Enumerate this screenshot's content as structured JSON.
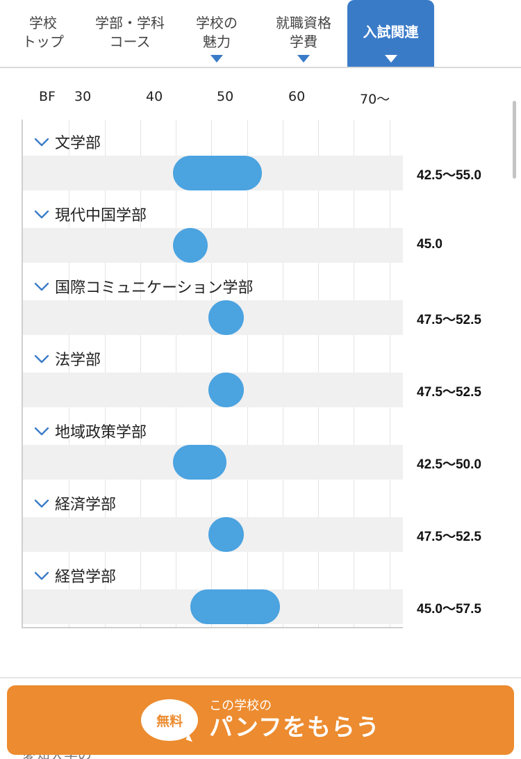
{
  "tabs": [
    {
      "lines": [
        "学校",
        "トップ"
      ],
      "active": false,
      "caret": false
    },
    {
      "lines": [
        "学部・学科",
        "コース"
      ],
      "active": false,
      "caret": false
    },
    {
      "lines": [
        "学校の",
        "魅力"
      ],
      "active": false,
      "caret": true
    },
    {
      "lines": [
        "就職資格",
        "学費"
      ],
      "active": false,
      "caret": true
    },
    {
      "lines": [
        "入試関連"
      ],
      "active": true,
      "caret": true
    }
  ],
  "axis": {
    "bf_label": "BF",
    "ticks": [
      "30",
      "40",
      "50",
      "60",
      "70〜"
    ]
  },
  "chart_data": {
    "type": "bar",
    "categories": [
      "文学部",
      "現代中国学部",
      "国際コミュニケーション学部",
      "法学部",
      "地域政策学部",
      "経済学部",
      "経営学部"
    ],
    "series": [
      {
        "low": [
          42.5,
          45.0,
          47.5,
          47.5,
          42.5,
          47.5,
          45.0
        ],
        "high": [
          55.0,
          45.0,
          52.5,
          52.5,
          50.0,
          52.5,
          57.5
        ]
      }
    ],
    "range_labels": [
      "42.5〜55.0",
      "45.0",
      "47.5〜52.5",
      "47.5〜52.5",
      "42.5〜50.0",
      "47.5〜52.5",
      "45.0〜57.5"
    ],
    "xlim": [
      25,
      77.5
    ],
    "grid": true,
    "bar_color": "#4ba3e0"
  },
  "cta": {
    "badge": "無料",
    "small": "この学校の",
    "big": "パンフをもらう"
  },
  "peek_text": "愛知大学の",
  "colors": {
    "accent": "#3a7bc8",
    "cta": "#ec8b2f",
    "bar": "#4ba3e0"
  }
}
